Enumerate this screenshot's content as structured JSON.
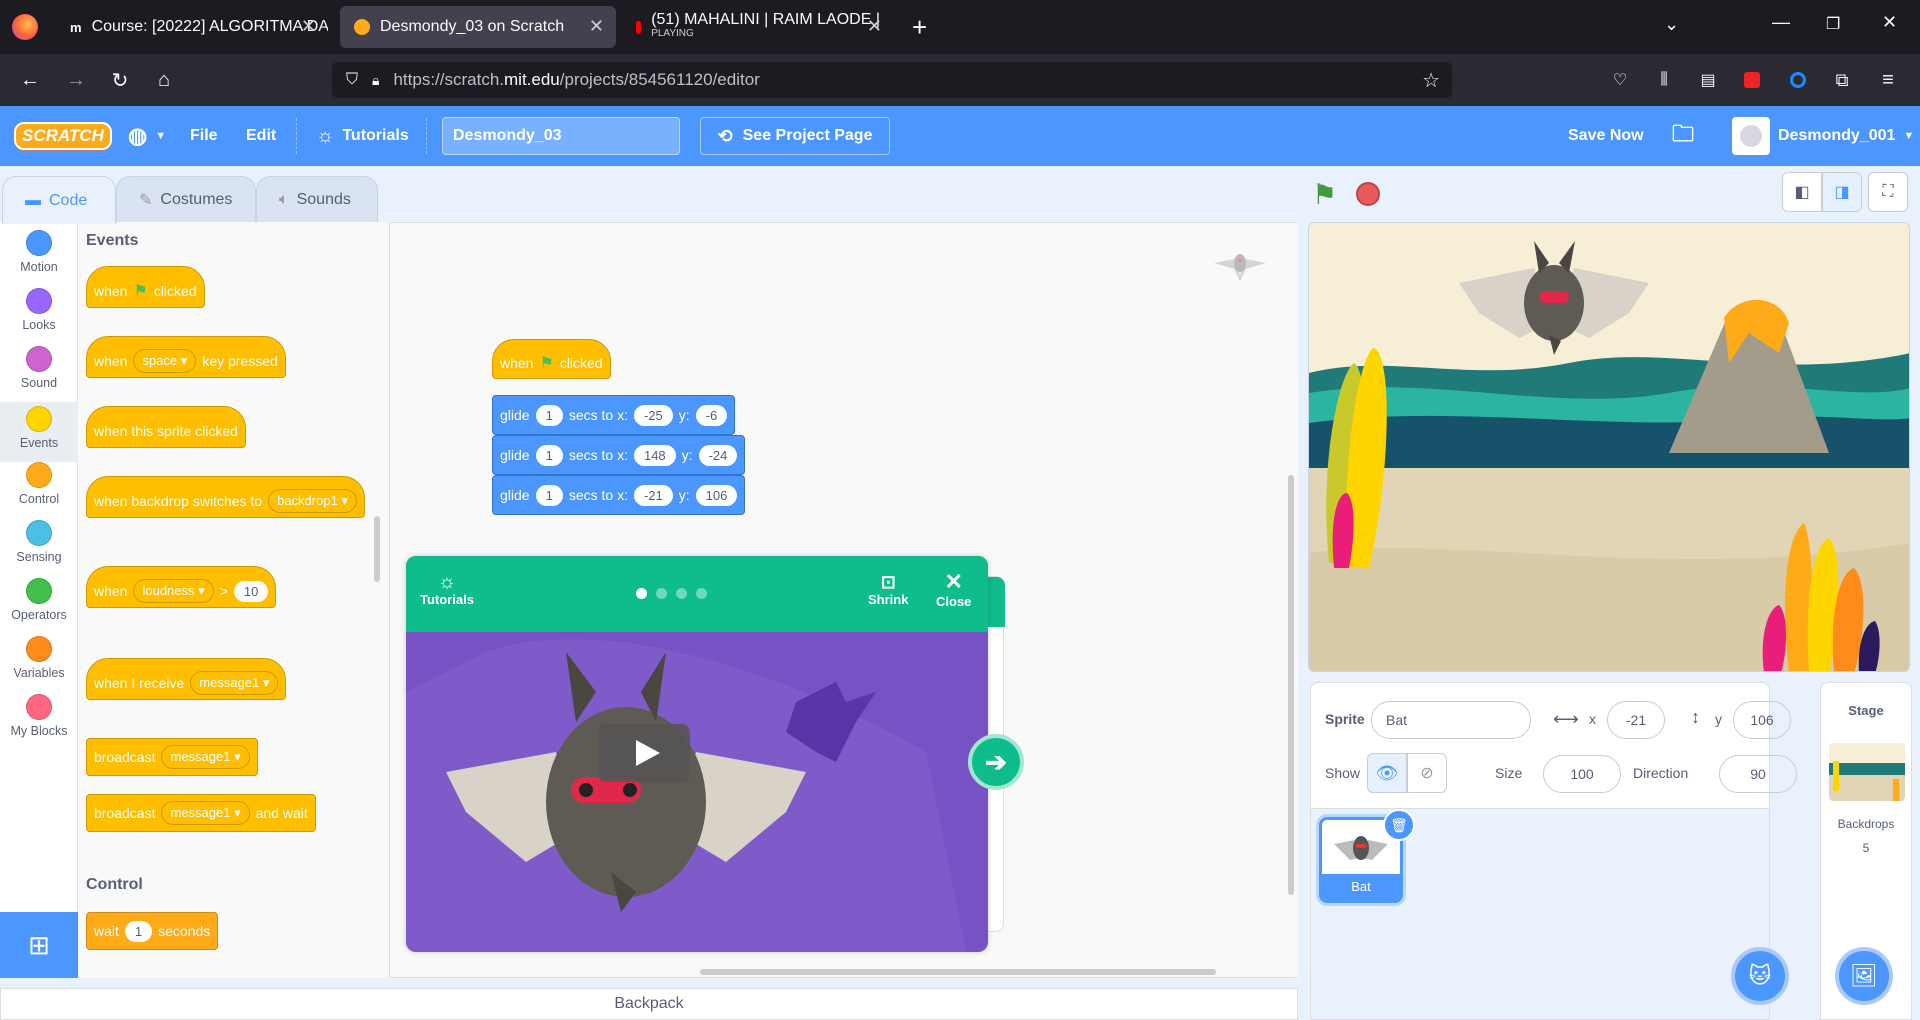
{
  "browser": {
    "tabs": [
      {
        "title": "Course: [20222] ALGORITMA DA",
        "icon": "moodle-icon"
      },
      {
        "title": "Desmondy_03 on Scratch",
        "icon": "scratch-icon"
      },
      {
        "title": "(51) MAHALINI | RAIM LAODE |",
        "subtitle": "PLAYING",
        "icon": "youtube-icon"
      }
    ],
    "url_prefix": "https://scratch.",
    "url_domain": "mit.edu",
    "url_path": "/projects/854561120/editor"
  },
  "menu": {
    "file": "File",
    "edit": "Edit",
    "tutorials": "Tutorials",
    "project_title": "Desmondy_03",
    "see_project": "See Project Page",
    "save_now": "Save Now",
    "username": "Desmondy_001"
  },
  "editor_tabs": {
    "code": "Code",
    "costumes": "Costumes",
    "sounds": "Sounds"
  },
  "categories": [
    {
      "label": "Motion",
      "color": "#4c97ff"
    },
    {
      "label": "Looks",
      "color": "#9966ff"
    },
    {
      "label": "Sound",
      "color": "#cf63cf"
    },
    {
      "label": "Events",
      "color": "#ffd500"
    },
    {
      "label": "Control",
      "color": "#ffab19"
    },
    {
      "label": "Sensing",
      "color": "#4cbfe6"
    },
    {
      "label": "Operators",
      "color": "#40bf4a"
    },
    {
      "label": "Variables",
      "color": "#ff8c1a"
    },
    {
      "label": "My Blocks",
      "color": "#ff6680"
    }
  ],
  "palette": {
    "events_header": "Events",
    "control_header": "Control",
    "when": "when",
    "clicked": "clicked",
    "space": "space",
    "key_pressed": "key pressed",
    "when_sprite_clicked": "when this sprite clicked",
    "when_backdrop": "when backdrop switches to",
    "backdrop1": "backdrop1",
    "loudness": "loudness",
    "gt": ">",
    "loudness_val": "10",
    "when_receive": "when I receive",
    "message1": "message1",
    "broadcast": "broadcast",
    "and_wait": "and wait",
    "wait": "wait",
    "wait_val": "1",
    "seconds": "seconds"
  },
  "script": {
    "when": "when",
    "clicked": "clicked",
    "glide": "glide",
    "secs_to_x": "secs to x:",
    "y": "y:",
    "glides": [
      {
        "secs": "1",
        "x": "-25",
        "y": "-6"
      },
      {
        "secs": "1",
        "x": "148",
        "y": "-24"
      },
      {
        "secs": "1",
        "x": "-21",
        "y": "106"
      }
    ]
  },
  "tutorial": {
    "label": "Tutorials",
    "shrink": "Shrink",
    "close": "Close",
    "pages": 4,
    "current_page": 1
  },
  "backpack": "Backpack",
  "sprite_info": {
    "sprite_label": "Sprite",
    "sprite_name": "Bat",
    "x_label": "x",
    "x": "-21",
    "y_label": "y",
    "y": "106",
    "show_label": "Show",
    "size_label": "Size",
    "size": "100",
    "direction_label": "Direction",
    "direction": "90",
    "selected_sprite": "Bat"
  },
  "stage_panel": {
    "title": "Stage",
    "backdrops_label": "Backdrops",
    "backdrops_count": "5"
  }
}
